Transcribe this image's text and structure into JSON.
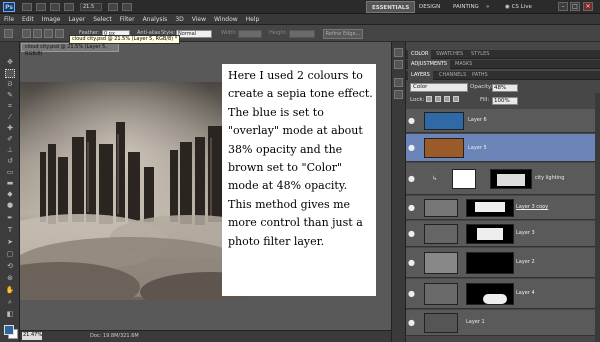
{
  "app": {
    "title_logo": "Ps",
    "zoom": "21.5",
    "cs_live": "CS Live"
  },
  "workspace": {
    "essentials": "ESSENTIALS",
    "design": "DESIGN",
    "painting": "PAINTING",
    "more": "»"
  },
  "window_controls": {
    "minimize": "–",
    "restore": "□",
    "close": "✕"
  },
  "menu": [
    "File",
    "Edit",
    "Image",
    "Layer",
    "Select",
    "Filter",
    "Analysis",
    "3D",
    "View",
    "Window",
    "Help"
  ],
  "options": {
    "feather_label": "Feather:",
    "feather_value": "0 px",
    "antialias": "Anti-alias",
    "style_label": "Style:",
    "style_value": "Normal",
    "width_label": "Width:",
    "height_label": "Height:",
    "refine": "Refine Edge..."
  },
  "document": {
    "tab": "cloud city.psd @ 21.5% (Layer 5, RGB/8)",
    "tooltip": "cloud city.psd @ 21.5% (Layer 5, RGB/8) *",
    "zoom_status": "21.47%",
    "doc_size": "Doc: 19.8M/321.6M"
  },
  "text_overlay": [
    "Here I used 2 colours to",
    "create a sepia tone effect.",
    "The blue is set to",
    "\"overlay\" mode at about",
    "38% opacity and the",
    "brown set to \"Color\"",
    "mode at 48% opacity.",
    "This method gives me",
    "more control than just a",
    "photo filter layer."
  ],
  "panels": {
    "tabs1": [
      "COLOR",
      "SWATCHES",
      "STYLES"
    ],
    "tabs2": [
      "ADJUSTMENTS",
      "MASKS"
    ],
    "tabs3": [
      "LAYERS",
      "CHANNELS",
      "PATHS"
    ],
    "blend_mode": "Color",
    "opacity_label": "Opacity:",
    "opacity_value": "48%",
    "lock_label": "Lock:",
    "fill_label": "Fill:",
    "fill_value": "100%"
  },
  "layers": [
    {
      "name": "Layer 6",
      "thumb": "#2f6aa6",
      "selected": false
    },
    {
      "name": "Layer 5",
      "thumb": "#9a5a2a",
      "selected": true
    },
    {
      "name": "city lighting",
      "thumb": "#ffffff",
      "selected": false
    },
    {
      "name": "Layer 3 copy",
      "thumb": "#777777",
      "selected": false
    },
    {
      "name": "Layer 3",
      "thumb": "#666666",
      "selected": false
    },
    {
      "name": "Layer 2",
      "thumb": "#888888",
      "selected": false
    },
    {
      "name": "Layer 4",
      "thumb": "#6a6a6a",
      "selected": false
    },
    {
      "name": "Layer 1",
      "thumb": "#555555",
      "selected": false
    }
  ],
  "colors": {
    "foreground": "#2e64a0",
    "background": "#ffffff"
  }
}
